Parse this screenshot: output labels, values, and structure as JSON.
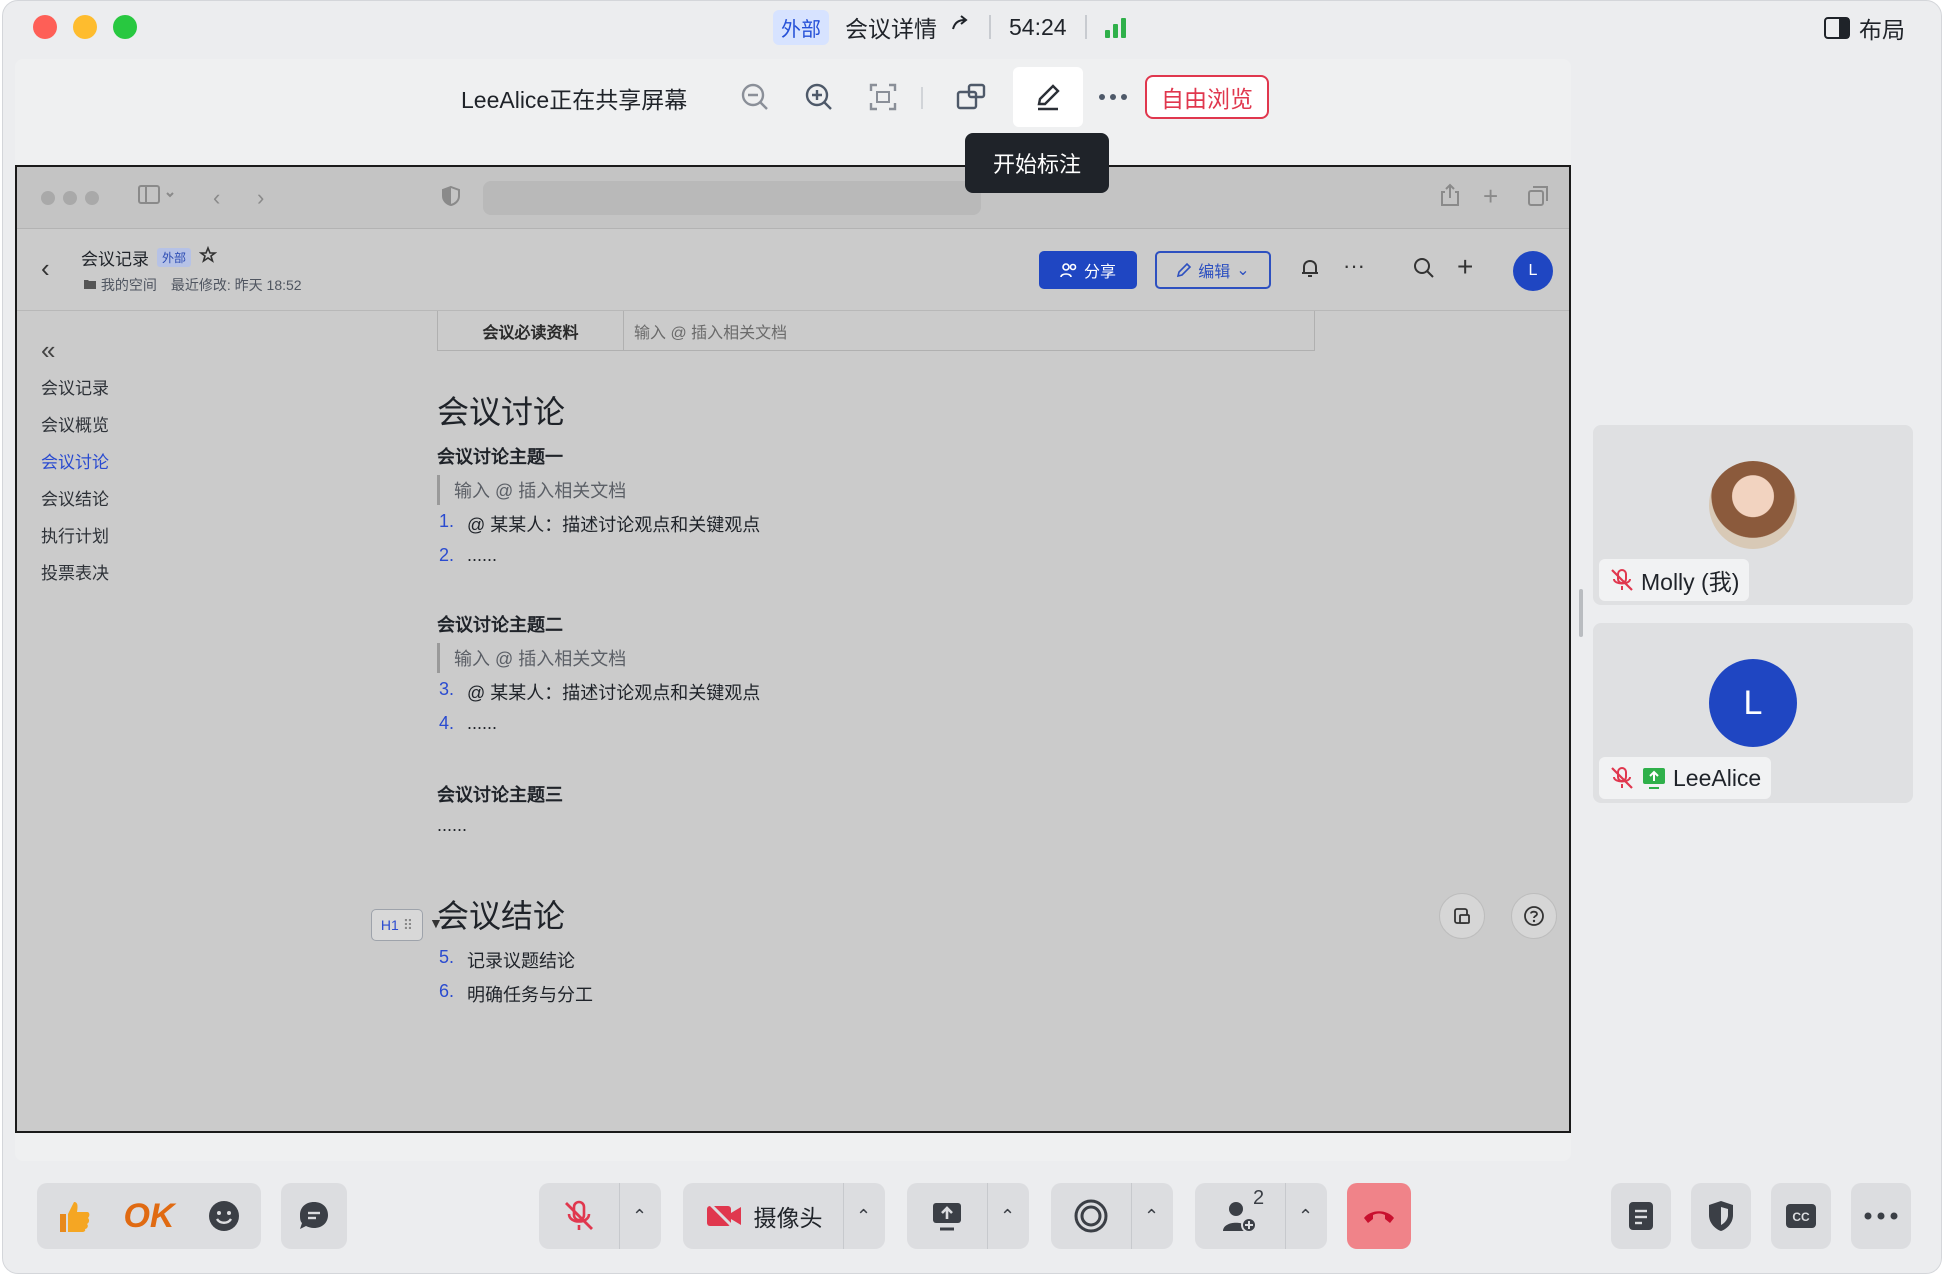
{
  "titlebar": {
    "external_badge": "外部",
    "meeting_details": "会议详情",
    "timer": "54:24",
    "layout_label": "布局"
  },
  "share_toolbar": {
    "sharing_text": "LeeAlice正在共享屏幕",
    "free_browse_label": "自由浏览",
    "tooltip": "开始标注"
  },
  "doc": {
    "title": "会议记录",
    "external_badge": "外部",
    "space": "我的空间",
    "last_modified": "最近修改: 昨天 18:52",
    "share_label": "分享",
    "edit_label": "编辑",
    "user_initial": "L",
    "toc": {
      "items": [
        "会议记录",
        "会议概览",
        "会议讨论",
        "会议结论",
        "执行计划",
        "投票表决"
      ],
      "active": "会议讨论"
    },
    "table": {
      "label": "会议必读资料",
      "placeholder": "输入 @ 插入相关文档"
    },
    "section_discussion": "会议讨论",
    "topic1": "会议讨论主题一",
    "topic1_quote": "输入 @ 插入相关文档",
    "topic1_items": [
      {
        "num": "1.",
        "text": "@ 某某人：描述讨论观点和关键观点"
      },
      {
        "num": "2.",
        "text": "......"
      }
    ],
    "topic2": "会议讨论主题二",
    "topic2_quote": "输入 @ 插入相关文档",
    "topic2_items": [
      {
        "num": "3.",
        "text": "@ 某某人：描述讨论观点和关键观点"
      },
      {
        "num": "4.",
        "text": "......"
      }
    ],
    "topic3": "会议讨论主题三",
    "topic3_text": "......",
    "heading_handle": "H1",
    "section_conclusion": "会议结论",
    "conclusion_items": [
      {
        "num": "5.",
        "text": "记录议题结论"
      },
      {
        "num": "6.",
        "text": "明确任务与分工"
      }
    ]
  },
  "participants": [
    {
      "name": "Molly (我)",
      "muted": true
    },
    {
      "name": "LeeAlice",
      "initial": "L",
      "muted": true,
      "sharing": true
    }
  ],
  "bottom_bar": {
    "ok_reaction": "OK",
    "camera_label": "摄像头",
    "participant_count": "2"
  },
  "colors": {
    "accent_blue": "#1f46c2",
    "free_browse_red": "#e0374e",
    "hangup_red": "#f08389",
    "signal_green": "#2fb04a"
  }
}
